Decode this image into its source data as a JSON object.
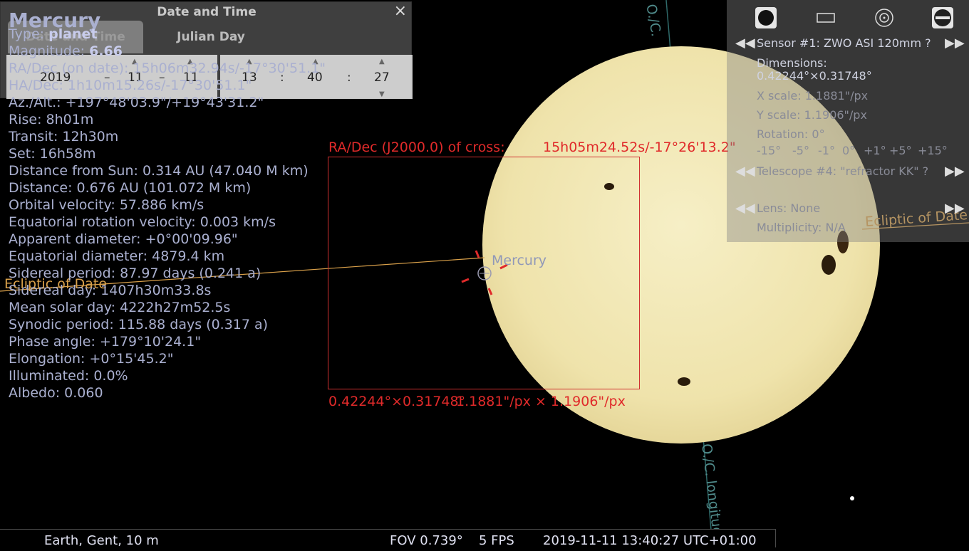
{
  "object": {
    "name": "Mercury",
    "type_label": "Type:",
    "type_value": "planet",
    "magnitude_label": "Magnitude:",
    "magnitude_value": "6.66",
    "lines": [
      "RA/Dec (on date): 15h06m32.94s/-17°30'51.1\"",
      "HA/Dec: 1h10m15.26s/-17°30'51.1\"",
      "Az./Alt.: +197°48'03.9\"/+19°43'31.2\"",
      "Rise: 8h01m",
      "Transit: 12h30m",
      "Set: 16h58m",
      "Distance from Sun: 0.314 AU (47.040 M km)",
      "Distance: 0.676 AU (101.072 M km)",
      "Orbital velocity: 57.886 km/s",
      "Equatorial rotation velocity: 0.003 km/s",
      "Apparent diameter: +0°00'09.96\"",
      "Equatorial diameter: 4879.4 km",
      "Sidereal period: 87.97 days (0.241 a)",
      "Sidereal day: 1407h30m33.8s",
      "Mean solar day: 4222h27m52.5s",
      "Synodic period: 115.88 days (0.317 a)",
      "Phase angle: +179°10'24.1\"",
      "Elongation: +0°15'45.2\"",
      "Illuminated: 0.0%",
      "Albedo: 0.060"
    ]
  },
  "datetime_dialog": {
    "title": "Date and Time",
    "close": "×",
    "tabs": [
      "Date and Time",
      "Julian Day"
    ],
    "year": "2019",
    "month": "11",
    "day": "11",
    "hour": "13",
    "minute": "40",
    "second": "27",
    "date_sep": "–",
    "time_sep": ":"
  },
  "sensor_panel": {
    "sensor": "Sensor #1: ZWO ASI 120mm ?",
    "dimensions_label": "Dimensions:",
    "dimensions_value": "0.42244°×0.31748°",
    "x_scale": "X scale: 1.1881\"/px",
    "y_scale": "Y scale: 1.1906\"/px",
    "rotation": "Rotation: 0°",
    "rotation_steps": [
      "-15°",
      "-5°",
      "-1°",
      "0°",
      "+1°",
      "+5°",
      "+15°"
    ],
    "telescope": "Telescope #4: \"refractor KK\" ?",
    "lens": "Lens: None",
    "multiplicity": "Multiplicity: N/A"
  },
  "sky": {
    "frame_top_label": "RA/Dec (J2000.0) of cross:",
    "frame_top_value": "15h05m24.52s/-17°26'13.2\"",
    "frame_bottom_dims": "0.42244°×0.31748°",
    "frame_bottom_scale": "1.1881\"/px × 1.1906\"/px",
    "mercury_label": "Mercury",
    "ecliptic_left": "Ecliptic of Date",
    "ecliptic_right": "Ecliptic of Date",
    "longitude_top": "O./C.",
    "longitude_bottom": "O./C. longitude"
  },
  "colors": {
    "sun_fill": "#f1e8b2",
    "ecliptic": "#d9a04a",
    "reticle": "#e02a2a",
    "info_text": "#aab0d0"
  },
  "status_bar": {
    "location": "Earth, Gent, 10 m",
    "fov": "FOV 0.739°",
    "fps": "5 FPS",
    "datetime": "2019-11-11 13:40:27 UTC+01:00"
  }
}
